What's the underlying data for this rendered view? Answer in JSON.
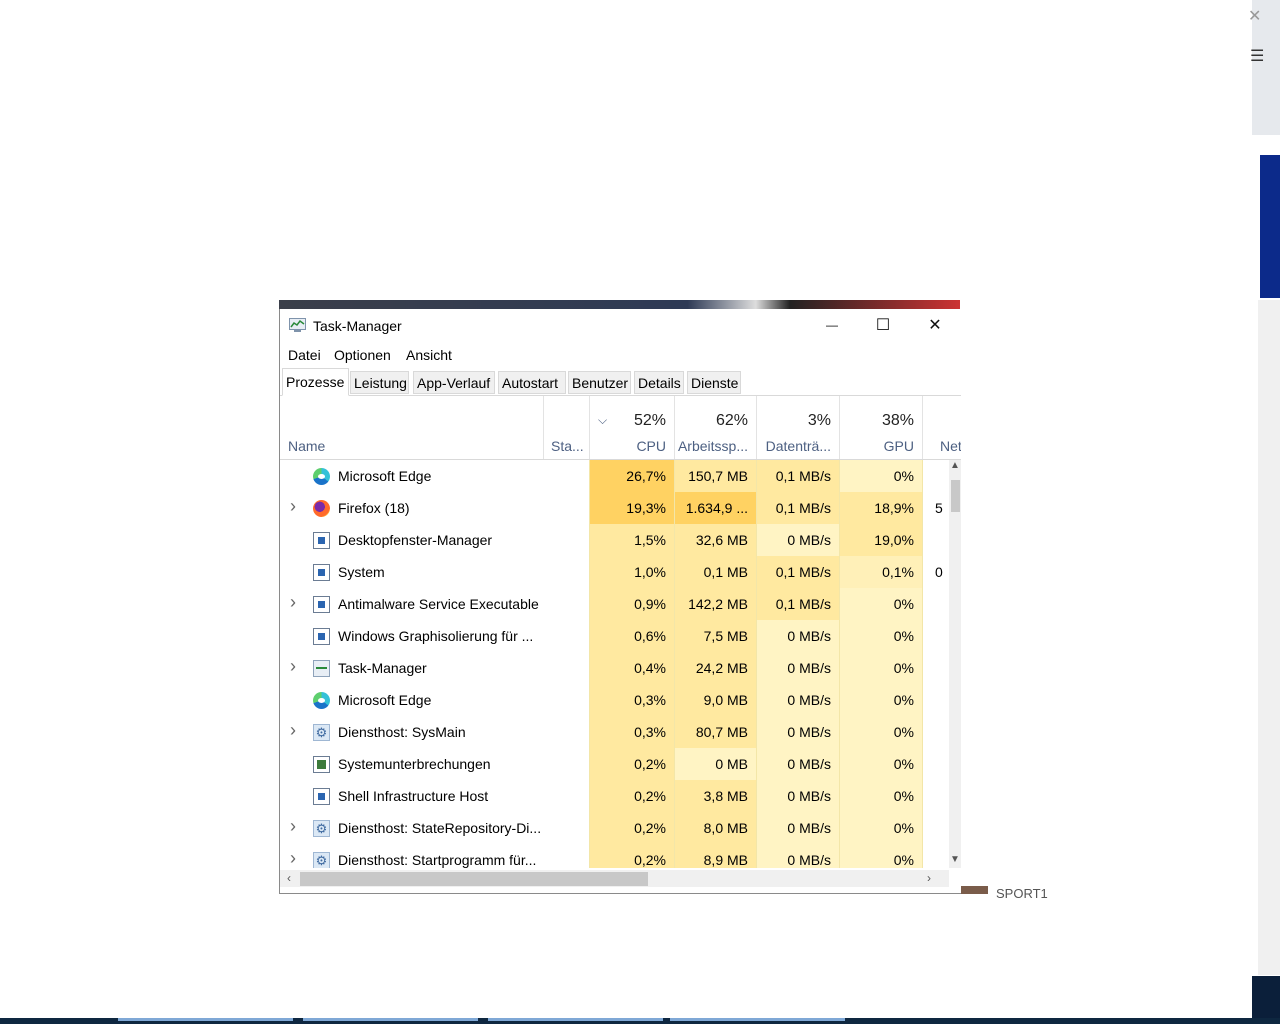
{
  "window": {
    "title": "Task-Manager",
    "minimize_glyph": "—",
    "maximize_glyph": "☐",
    "close_glyph": "✕"
  },
  "menu": [
    "Datei",
    "Optionen",
    "Ansicht"
  ],
  "tabs": [
    "Prozesse",
    "Leistung",
    "App-Verlauf",
    "Autostart",
    "Benutzer",
    "Details",
    "Dienste"
  ],
  "active_tab": "Prozesse",
  "columns": {
    "name": "Name",
    "status": "Sta...",
    "cpu": {
      "pct": "52%",
      "label": "CPU"
    },
    "mem": {
      "pct": "62%",
      "label": "Arbeitssp..."
    },
    "disk": {
      "pct": "3%",
      "label": "Datenträ..."
    },
    "gpu": {
      "pct": "38%",
      "label": "GPU"
    },
    "net": {
      "label": "Net"
    }
  },
  "processes": [
    {
      "name": "Microsoft Edge",
      "icon": "edge-icon",
      "expandable": false,
      "cpu": "26,7%",
      "mem": "150,7 MB",
      "disk": "0,1 MB/s",
      "gpu": "0%",
      "net": ""
    },
    {
      "name": "Firefox (18)",
      "icon": "firefox-icon",
      "expandable": true,
      "cpu": "19,3%",
      "mem": "1.634,9 ...",
      "disk": "0,1 MB/s",
      "gpu": "18,9%",
      "net": "5"
    },
    {
      "name": "Desktopfenster-Manager",
      "icon": "window-icon",
      "expandable": false,
      "cpu": "1,5%",
      "mem": "32,6 MB",
      "disk": "0 MB/s",
      "gpu": "19,0%",
      "net": ""
    },
    {
      "name": "System",
      "icon": "window-icon",
      "expandable": false,
      "cpu": "1,0%",
      "mem": "0,1 MB",
      "disk": "0,1 MB/s",
      "gpu": "0,1%",
      "net": "0"
    },
    {
      "name": "Antimalware Service Executable",
      "icon": "window-icon",
      "expandable": true,
      "cpu": "0,9%",
      "mem": "142,2 MB",
      "disk": "0,1 MB/s",
      "gpu": "0%",
      "net": ""
    },
    {
      "name": "Windows Graphisolierung für ...",
      "icon": "window-icon",
      "expandable": false,
      "cpu": "0,6%",
      "mem": "7,5 MB",
      "disk": "0 MB/s",
      "gpu": "0%",
      "net": ""
    },
    {
      "name": "Task-Manager",
      "icon": "task-manager-icon",
      "expandable": true,
      "cpu": "0,4%",
      "mem": "24,2 MB",
      "disk": "0 MB/s",
      "gpu": "0%",
      "net": ""
    },
    {
      "name": "Microsoft Edge",
      "icon": "edge-icon",
      "expandable": false,
      "cpu": "0,3%",
      "mem": "9,0 MB",
      "disk": "0 MB/s",
      "gpu": "0%",
      "net": ""
    },
    {
      "name": "Diensthost: SysMain",
      "icon": "gear-icon",
      "expandable": true,
      "cpu": "0,3%",
      "mem": "80,7 MB",
      "disk": "0 MB/s",
      "gpu": "0%",
      "net": ""
    },
    {
      "name": "Systemunterbrechungen",
      "icon": "system-interrupts-icon",
      "expandable": false,
      "cpu": "0,2%",
      "mem": "0 MB",
      "disk": "0 MB/s",
      "gpu": "0%",
      "net": ""
    },
    {
      "name": "Shell Infrastructure Host",
      "icon": "window-icon",
      "expandable": false,
      "cpu": "0,2%",
      "mem": "3,8 MB",
      "disk": "0 MB/s",
      "gpu": "0%",
      "net": ""
    },
    {
      "name": "Diensthost: StateRepository-Di...",
      "icon": "gear-icon",
      "expandable": true,
      "cpu": "0,2%",
      "mem": "8,0 MB",
      "disk": "0 MB/s",
      "gpu": "0%",
      "net": ""
    },
    {
      "name": "Diensthost: Startprogramm für...",
      "icon": "gear-icon",
      "expandable": true,
      "cpu": "0,2%",
      "mem": "8,9 MB",
      "disk": "0 MB/s",
      "gpu": "0%",
      "net": ""
    }
  ],
  "background": {
    "sport_label": "SPORT1"
  },
  "colors": {
    "heat_high": "#ffd262",
    "heat_mid": "#ffe9a0",
    "heat_low": "#fff4c4",
    "header_label": "#4d6082"
  }
}
